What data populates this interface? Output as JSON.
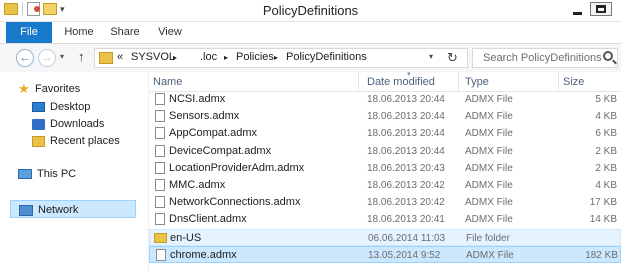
{
  "window": {
    "title": "PolicyDefinitions",
    "minimize_glyph": "",
    "maximize_glyph": ""
  },
  "ribbon": {
    "tabs": [
      "File",
      "Home",
      "Share",
      "View"
    ]
  },
  "address": {
    "prefix": "«",
    "crumbs": [
      "SYSVOL",
      ".loc",
      "Policies",
      "PolicyDefinitions"
    ],
    "separator": "▸",
    "search_placeholder": "Search PolicyDefinitions"
  },
  "nav": {
    "favorites": "Favorites",
    "desktop": "Desktop",
    "downloads": "Downloads",
    "recent": "Recent places",
    "this_pc": "This PC",
    "network": "Network"
  },
  "columns": {
    "name": "Name",
    "date": "Date modified",
    "type": "Type",
    "size": "Size"
  },
  "files": [
    {
      "name": "NCSI.admx",
      "date": "18.06.2013 20:44",
      "type": "ADMX File",
      "size": "5 KB",
      "icon": "file-icon"
    },
    {
      "name": "Sensors.admx",
      "date": "18.06.2013 20:44",
      "type": "ADMX File",
      "size": "4 KB",
      "icon": "file-icon"
    },
    {
      "name": "AppCompat.admx",
      "date": "18.06.2013 20:44",
      "type": "ADMX File",
      "size": "6 KB",
      "icon": "file-icon"
    },
    {
      "name": "DeviceCompat.admx",
      "date": "18.06.2013 20:44",
      "type": "ADMX File",
      "size": "2 KB",
      "icon": "file-icon"
    },
    {
      "name": "LocationProviderAdm.admx",
      "date": "18.06.2013 20:43",
      "type": "ADMX File",
      "size": "2 KB",
      "icon": "file-icon"
    },
    {
      "name": "MMC.admx",
      "date": "18.06.2013 20:42",
      "type": "ADMX File",
      "size": "4 KB",
      "icon": "file-icon"
    },
    {
      "name": "NetworkConnections.admx",
      "date": "18.06.2013 20:42",
      "type": "ADMX File",
      "size": "17 KB",
      "icon": "file-icon"
    },
    {
      "name": "DnsClient.admx",
      "date": "18.06.2013 20:41",
      "type": "ADMX File",
      "size": "14 KB",
      "icon": "file-icon"
    },
    {
      "name": "en-US",
      "date": "06.06.2014 11:03",
      "type": "File folder",
      "size": "",
      "icon": "folder-icon"
    },
    {
      "name": "chrome.admx",
      "date": "13.05.2014 9:52",
      "type": "ADMX File",
      "size": "182 KB",
      "icon": "file-icon"
    }
  ],
  "colors": {
    "accent": "#1979ca",
    "selection": "#cce8ff",
    "hover": "#e5f3ff",
    "header_text": "#4c607a"
  }
}
